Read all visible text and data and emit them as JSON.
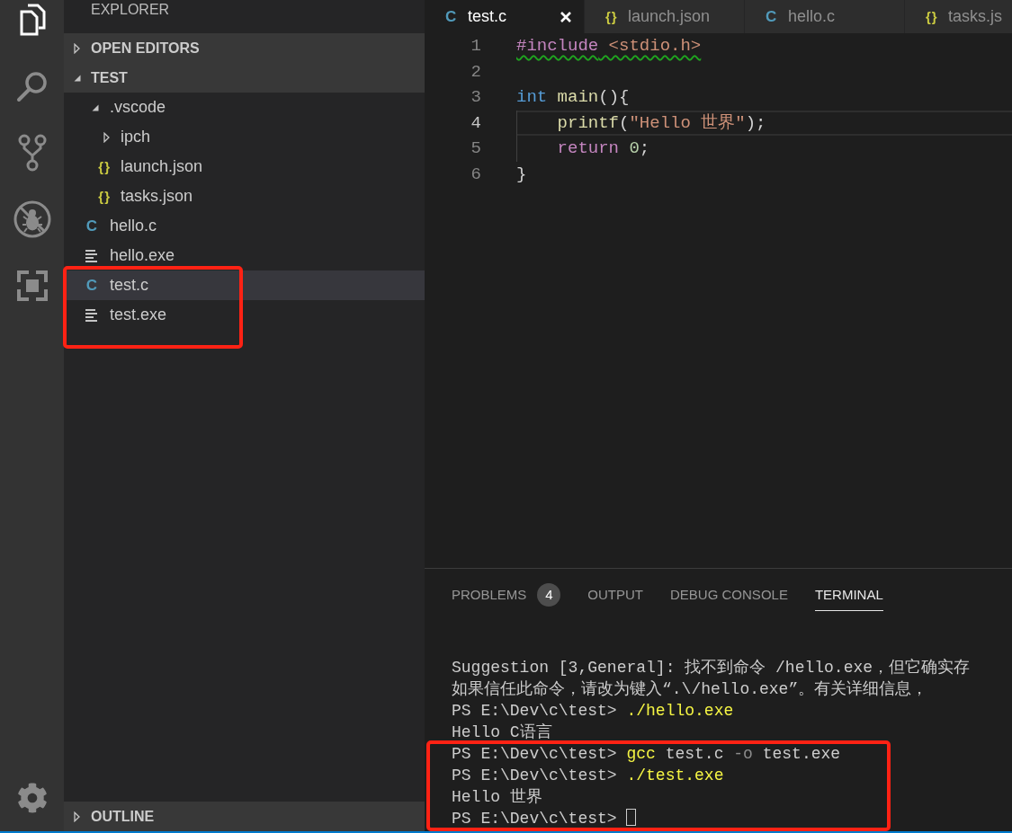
{
  "activity_bar": {
    "items": [
      {
        "kind": "files",
        "selected": true
      },
      {
        "kind": "search",
        "selected": false
      },
      {
        "kind": "source_control",
        "selected": false
      },
      {
        "kind": "debug",
        "selected": false
      },
      {
        "kind": "extensions",
        "selected": false
      }
    ],
    "bottom_items": [
      {
        "kind": "settings",
        "selected": false
      }
    ]
  },
  "sidebar": {
    "title": "EXPLORER",
    "sections": [
      {
        "title": "OPEN EDITORS",
        "expanded": false
      },
      {
        "title": "TEST",
        "expanded": true,
        "tree": [
          {
            "name": ".vscode",
            "kind": "folder",
            "expanded": true,
            "selected": false,
            "highlighted": false,
            "children": [
              {
                "name": "ipch",
                "kind": "folder",
                "expanded": false,
                "selected": false,
                "highlighted": false
              },
              {
                "name": "launch.json",
                "kind": "json",
                "icon": "{}",
                "selected": false,
                "highlighted": false
              },
              {
                "name": "tasks.json",
                "kind": "json",
                "icon": "{}",
                "selected": false,
                "highlighted": false
              }
            ]
          },
          {
            "name": "hello.c",
            "kind": "c",
            "icon": "C",
            "selected": false,
            "highlighted": false
          },
          {
            "name": "hello.exe",
            "kind": "exe",
            "selected": false,
            "highlighted": false
          },
          {
            "name": "test.c",
            "kind": "c",
            "icon": "C",
            "selected": true,
            "highlighted": true
          },
          {
            "name": "test.exe",
            "kind": "exe",
            "selected": false,
            "highlighted": true
          }
        ]
      }
    ],
    "bottom_sections": [
      {
        "title": "OUTLINE",
        "expanded": false
      }
    ]
  },
  "editor": {
    "tabs": [
      {
        "label": "test.c",
        "kind": "c",
        "icon": "C",
        "selected": true
      },
      {
        "label": "launch.json",
        "kind": "json",
        "icon": "{}",
        "selected": false
      },
      {
        "label": "hello.c",
        "kind": "c",
        "icon": "C",
        "selected": false
      },
      {
        "label": "tasks.js",
        "kind": "json",
        "icon": "{}",
        "selected": false
      }
    ],
    "lines": [
      {
        "number": "1",
        "current": false,
        "indented": false,
        "squiggle": true,
        "tokens": [
          {
            "text": "#include",
            "kind": "directive"
          },
          {
            "text": " <stdio.h>",
            "kind": "header"
          }
        ]
      },
      {
        "number": "2",
        "current": false,
        "indented": false
      },
      {
        "number": "3",
        "current": false,
        "indented": false,
        "squiggle": false,
        "tokens": [
          {
            "text": "int",
            "kind": "type"
          },
          {
            "text": " main",
            "kind": "function"
          },
          {
            "text": "(){",
            "kind": "punct"
          }
        ]
      },
      {
        "number": "4",
        "current": true,
        "indented": true,
        "squiggle": false,
        "tokens": [
          {
            "text": "printf",
            "kind": "function"
          },
          {
            "text": "(",
            "kind": "punct"
          },
          {
            "text": "\"Hello 世界\"",
            "kind": "string"
          },
          {
            "text": ");",
            "kind": "punct"
          }
        ]
      },
      {
        "number": "5",
        "current": false,
        "indented": true,
        "squiggle": false,
        "tokens": [
          {
            "text": "return",
            "kind": "keyword"
          },
          {
            "text": " 0",
            "kind": "number"
          },
          {
            "text": ";",
            "kind": "punct"
          }
        ]
      },
      {
        "number": "6",
        "current": false,
        "indented": false,
        "squiggle": false,
        "tokens": [
          {
            "text": "}",
            "kind": "punct"
          }
        ]
      }
    ]
  },
  "panel": {
    "tabs": [
      {
        "label": "PROBLEMS",
        "badge": "4",
        "selected": false
      },
      {
        "label": "OUTPUT",
        "selected": false
      },
      {
        "label": "DEBUG CONSOLE",
        "selected": false
      },
      {
        "label": "TERMINAL",
        "selected": true
      }
    ],
    "terminal": {
      "lines": [
        {
          "segments": [
            {
              "text": "Suggestion [3,General]: 找不到命令 /hello.exe，但它确实存",
              "kind": "plain"
            }
          ],
          "cursor": false,
          "highlighted": false
        },
        {
          "segments": [
            {
              "text": "如果信任此命令，请改为键入“.\\/hello.exe”。有关详细信息，",
              "kind": "plain"
            }
          ],
          "cursor": false,
          "highlighted": false
        },
        {
          "segments": [
            {
              "text": "PS E:\\Dev\\c\\test> ",
              "kind": "plain"
            },
            {
              "text": "./hello.exe",
              "kind": "command"
            }
          ],
          "cursor": false,
          "highlighted": false
        },
        {
          "segments": [
            {
              "text": "Hello C语言",
              "kind": "plain"
            }
          ],
          "cursor": false,
          "highlighted": false
        },
        {
          "segments": [
            {
              "text": "PS E:\\Dev\\c\\test> ",
              "kind": "plain"
            },
            {
              "text": "gcc",
              "kind": "command"
            },
            {
              "text": " test.c ",
              "kind": "plain"
            },
            {
              "text": "-o",
              "kind": "flag"
            },
            {
              "text": " test.exe",
              "kind": "plain"
            }
          ],
          "cursor": false,
          "highlighted": true
        },
        {
          "segments": [
            {
              "text": "PS E:\\Dev\\c\\test> ",
              "kind": "plain"
            },
            {
              "text": "./test.exe",
              "kind": "command"
            }
          ],
          "cursor": false,
          "highlighted": true
        },
        {
          "segments": [
            {
              "text": "Hello 世界",
              "kind": "plain"
            }
          ],
          "cursor": false,
          "highlighted": true
        },
        {
          "segments": [
            {
              "text": "PS E:\\Dev\\c\\test> ",
              "kind": "plain"
            }
          ],
          "cursor": true,
          "highlighted": true
        }
      ]
    }
  }
}
